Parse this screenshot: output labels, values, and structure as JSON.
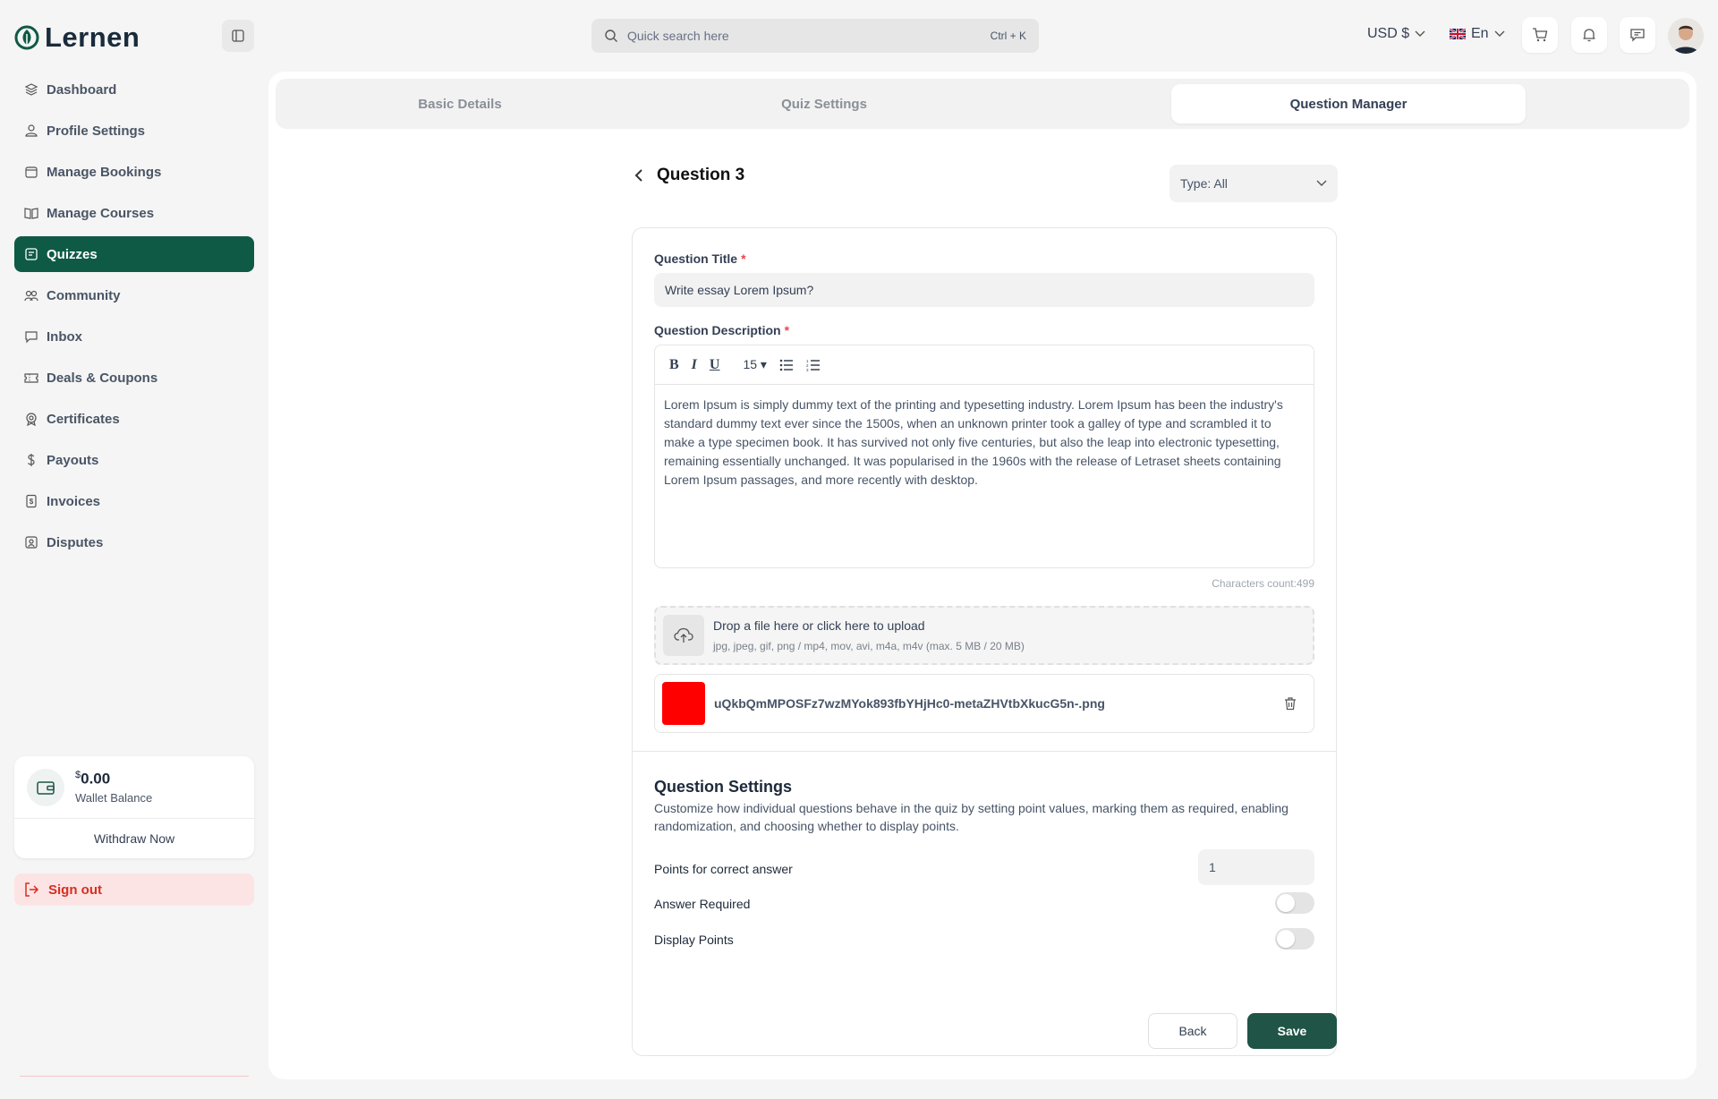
{
  "brand": {
    "name": "Lernen",
    "accent": "#0f5a45"
  },
  "header": {
    "search_placeholder": "Quick search here",
    "search_shortcut": "Ctrl + K",
    "currency": "USD $",
    "language": "En"
  },
  "sidebar": {
    "items": [
      {
        "label": "Dashboard",
        "icon": "layers-icon"
      },
      {
        "label": "Profile Settings",
        "icon": "user-icon"
      },
      {
        "label": "Manage Bookings",
        "icon": "calendar-icon"
      },
      {
        "label": "Manage Courses",
        "icon": "book-icon"
      },
      {
        "label": "Quizzes",
        "icon": "quiz-icon",
        "active": true
      },
      {
        "label": "Community",
        "icon": "community-icon"
      },
      {
        "label": "Inbox",
        "icon": "chat-icon"
      },
      {
        "label": "Deals & Coupons",
        "icon": "ticket-icon"
      },
      {
        "label": "Certificates",
        "icon": "certificate-icon"
      },
      {
        "label": "Payouts",
        "icon": "dollar-icon"
      },
      {
        "label": "Invoices",
        "icon": "invoice-icon"
      },
      {
        "label": "Disputes",
        "icon": "dispute-icon"
      }
    ],
    "wallet": {
      "currency_symbol": "$",
      "amount": "0.00",
      "label": "Wallet Balance",
      "withdraw": "Withdraw Now"
    },
    "signout": "Sign out"
  },
  "tabs": [
    {
      "label": "Basic Details"
    },
    {
      "label": "Quiz Settings"
    },
    {
      "label": "Question Manager",
      "active": true
    }
  ],
  "question": {
    "heading": "Question 3",
    "type_filter": "Type: All",
    "title_label": "Question Title",
    "title_value": "Write essay Lorem Ipsum?",
    "description_label": "Question Description",
    "font_size": "15",
    "description": "Lorem Ipsum is simply dummy text of the printing and typesetting industry. Lorem Ipsum has been the industry's standard dummy text ever since the 1500s, when an unknown printer took a galley of type and scrambled it to make a type specimen book. It has survived not only five centuries, but also the leap into electronic typesetting, remaining essentially unchanged. It was popularised in the 1960s with the release of Letraset sheets containing Lorem Ipsum passages, and more recently with desktop.",
    "char_count": "Characters count:499",
    "upload_title": "Drop a file here or click here to upload",
    "upload_hint": "jpg, jpeg, gif, png / mp4, mov, avi, m4a, m4v (max. 5 MB / 20 MB)",
    "file_name": "uQkbQmMPOSFz7wzMYok893fbYHjHc0-metaZHVtbXkucG5n-.png"
  },
  "settings": {
    "title": "Question Settings",
    "description": "Customize how individual questions behave in the quiz by setting point values, marking them as required, enabling randomization, and choosing whether to display points.",
    "points_label": "Points for correct answer",
    "points_value": "1",
    "answer_required_label": "Answer Required",
    "answer_required": false,
    "display_points_label": "Display Points",
    "display_points": false
  },
  "actions": {
    "back": "Back",
    "save": "Save"
  }
}
